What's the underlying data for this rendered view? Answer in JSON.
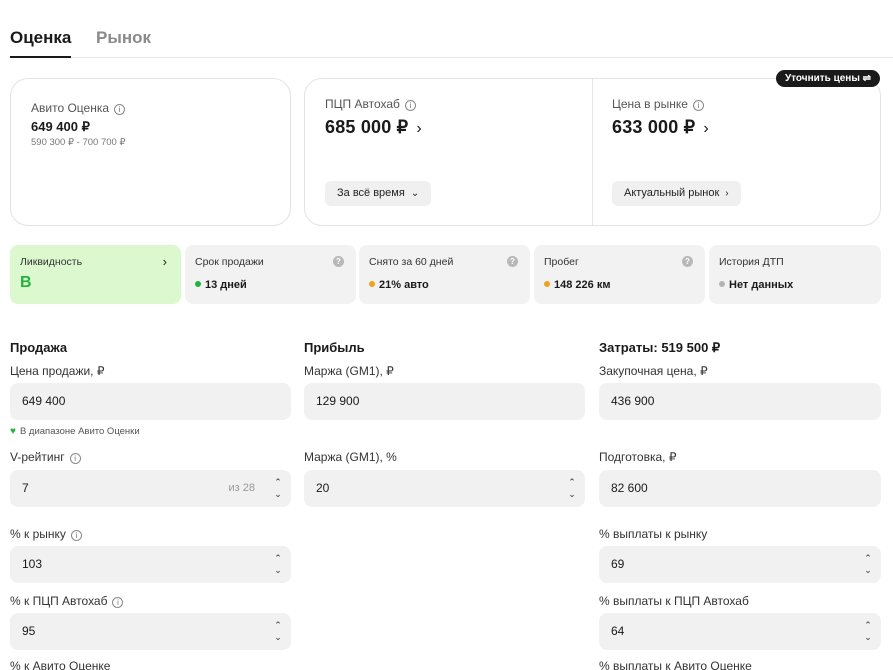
{
  "tabs": {
    "active": "Оценка",
    "inactive": "Рынок"
  },
  "avito_card": {
    "label": "Авито Оценка",
    "price": "649 400 ₽",
    "range": "590 300 ₽ - 700 700 ₽"
  },
  "pcp_card": {
    "label": "ПЦП Автохаб",
    "price": "685 000 ₽",
    "button": "За всё время"
  },
  "market_card": {
    "label": "Цена в рынке",
    "price": "633 000 ₽",
    "button": "Актуальный рынок"
  },
  "refine_button": "Уточнить цены",
  "metrics": [
    {
      "label": "Ликвидность",
      "value": "B",
      "color": "#22b33a"
    },
    {
      "label": "Срок продажи",
      "value": "13 дней",
      "color": "#22b33a"
    },
    {
      "label": "Снято за 60 дней",
      "value": "21% авто",
      "color": "#f0a21c"
    },
    {
      "label": "Пробег",
      "value": "148 226 км",
      "color": "#f0a21c"
    },
    {
      "label": "История ДТП",
      "value": "Нет данных",
      "color": "#b3b3b3"
    }
  ],
  "sale": {
    "title": "Продажа",
    "price_label": "Цена продажи, ₽",
    "price_value": "649 400",
    "hint": "В диапазоне Авито Оценки",
    "vrating_label": "V-рейтинг",
    "vrating_value": "7",
    "vrating_suffix": "из 28",
    "pct_market_label": "% к рынку",
    "pct_market_value": "103",
    "pct_pcp_label": "% к ПЦП Автохаб",
    "pct_pcp_value": "95",
    "pct_avito_label": "% к Авито Оценке"
  },
  "profit": {
    "title": "Прибыль",
    "margin_rub_label": "Маржа (GM1), ₽",
    "margin_rub_value": "129 900",
    "margin_pct_label": "Маржа (GM1), %",
    "margin_pct_value": "20"
  },
  "costs": {
    "title": "Затраты: 519 500 ₽",
    "purchase_label": "Закупочная цена, ₽",
    "purchase_value": "436 900",
    "prep_label": "Подготовка, ₽",
    "prep_value": "82 600",
    "payout_market_label": "% выплаты к рынку",
    "payout_market_value": "69",
    "payout_pcp_label": "% выплаты к ПЦП Автохаб",
    "payout_pcp_value": "64",
    "payout_avito_label": "% выплаты к Авито Оценке"
  }
}
